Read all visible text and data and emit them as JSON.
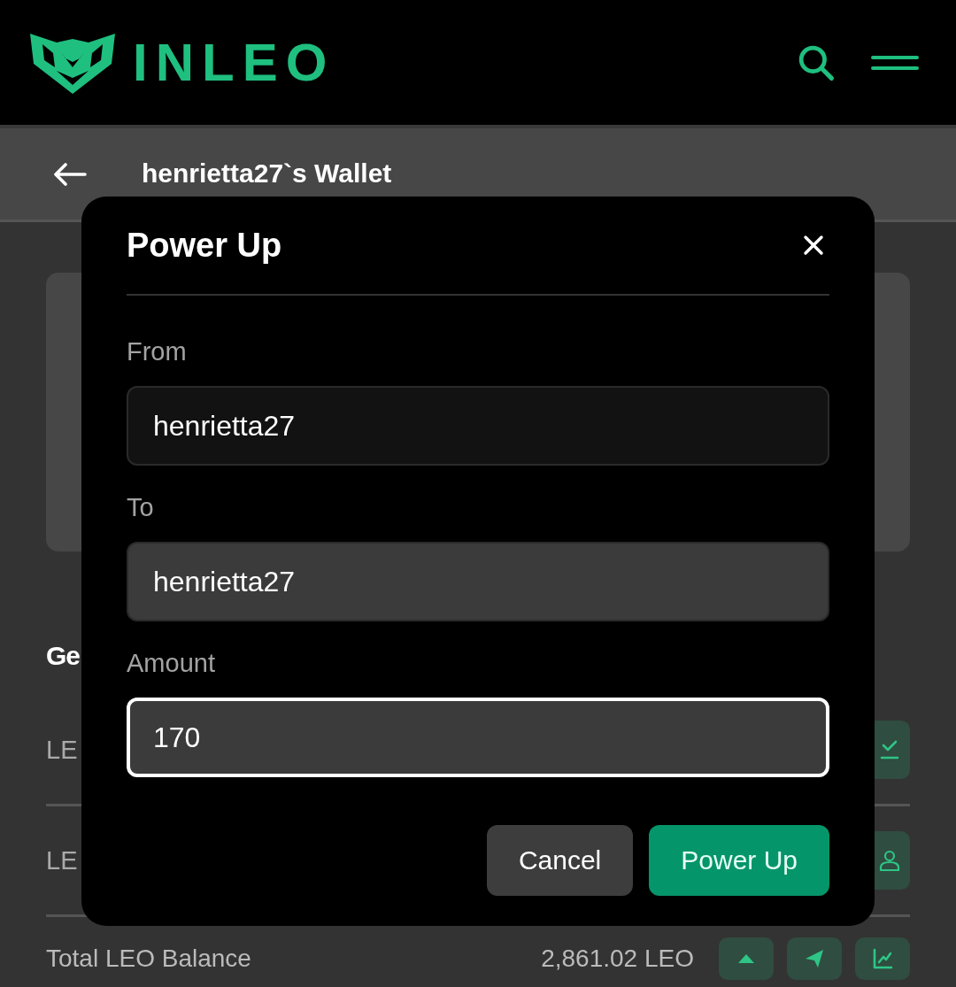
{
  "header": {
    "logo_text": "INLEO"
  },
  "page": {
    "title": "henrietta27`s Wallet",
    "section_heading": "Ge",
    "rows": [
      {
        "kind": "claim",
        "label": "LE"
      },
      {
        "kind": "delegate",
        "label": "LE"
      },
      {
        "kind": "total",
        "label": "Total LEO Balance",
        "value": "2,861.02 LEO"
      }
    ]
  },
  "dialog": {
    "title": "Power Up",
    "fields": [
      {
        "label": "From",
        "value": "henrietta27",
        "disabled": true,
        "focused": false
      },
      {
        "label": "To",
        "value": "henrietta27",
        "disabled": false,
        "focused": false
      },
      {
        "label": "Amount",
        "value": "170",
        "disabled": false,
        "focused": true
      }
    ],
    "buttons": [
      {
        "kind": "secondary",
        "label": "Cancel"
      },
      {
        "kind": "primary",
        "label": "Power Up"
      }
    ]
  }
}
